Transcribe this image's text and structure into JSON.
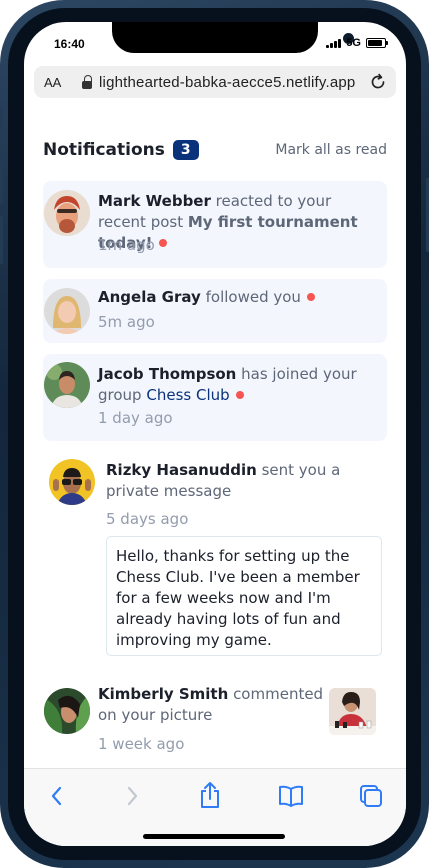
{
  "status": {
    "time": "16:40",
    "network": "5G"
  },
  "browser": {
    "text_size": "AA",
    "url": "lighthearted-babka-aecce5.netlify.app"
  },
  "page": {
    "title": "Notifications",
    "unread_count": "3",
    "mark_all": "Mark all as read"
  },
  "notifications": [
    {
      "name": "Mark Webber",
      "action": "reacted to your recent post",
      "target": "My first tournament today!",
      "time": "1m ago",
      "unread": true
    },
    {
      "name": "Angela Gray",
      "action": "followed you",
      "time": "5m ago",
      "unread": true
    },
    {
      "name": "Jacob Thompson",
      "action": "has joined your group",
      "target": "Chess Club",
      "time": "1 day ago",
      "unread": true
    },
    {
      "name": "Rizky Hasanuddin",
      "action": "sent you a private message",
      "time": "5 days ago",
      "unread": false,
      "message": "Hello, thanks for setting up the Chess Club. I've been a member for a few weeks now and I'm already having lots of fun and improving my game."
    },
    {
      "name": "Kimberly Smith",
      "action": "commented on your picture",
      "time": "1 week ago",
      "unread": false
    }
  ],
  "colors": {
    "accent": "#0a327b",
    "unread_bg": "#f3f6fd",
    "dot": "#f65552",
    "ios_blue": "#2f7cf6"
  },
  "icons": [
    "back-arrow-icon",
    "forward-arrow-icon",
    "share-icon",
    "bookmarks-icon",
    "tabs-icon",
    "lock-icon",
    "reload-icon"
  ]
}
